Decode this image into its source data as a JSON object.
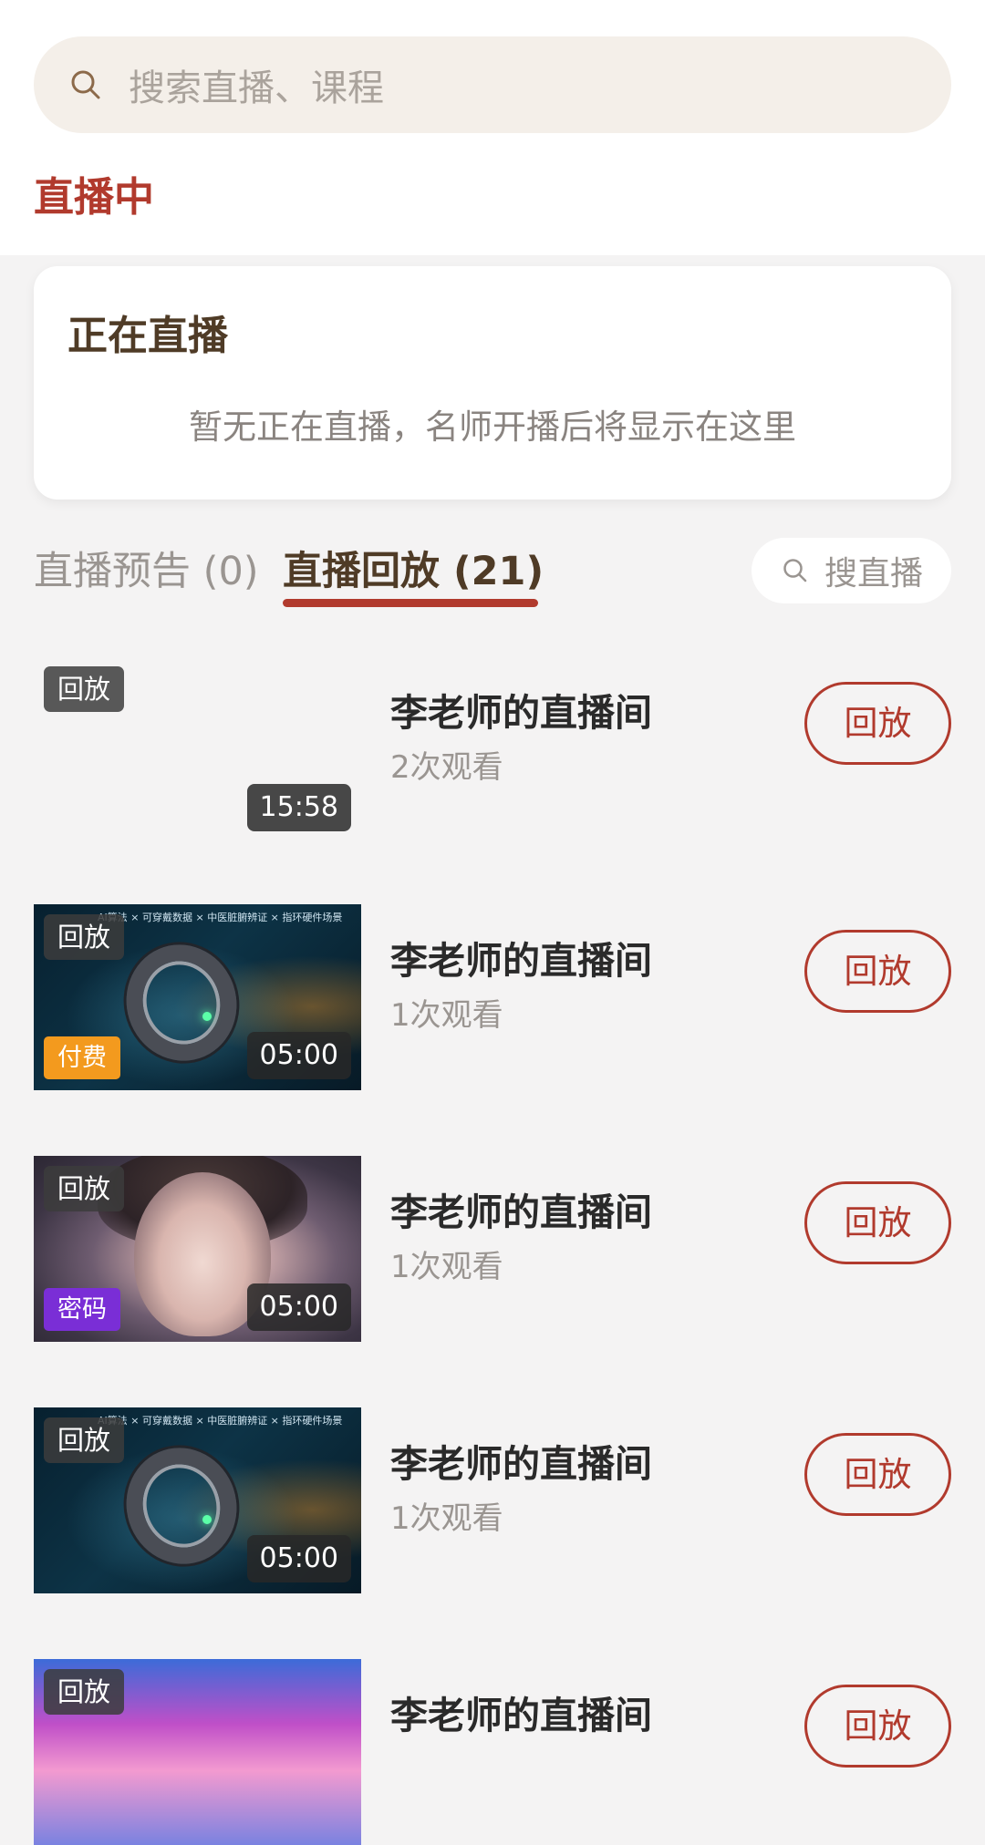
{
  "search": {
    "placeholder": "搜索直播、课程"
  },
  "section_title": "直播中",
  "live_now": {
    "title": "正在直播",
    "empty_text": "暂无正在直播，名师开播后将显示在这里"
  },
  "tabs": {
    "preview": "直播预告 (0)",
    "replay": "直播回放 (21)",
    "active": "replay"
  },
  "mini_search": {
    "label": "搜直播"
  },
  "thumbnail_caption": "AI算法 × 可穿戴数据 × 中医脏腑辨证 × 指环硬件场景",
  "colors": {
    "accent": "#b13a2d",
    "heading": "#4f3b26",
    "paid": "#f39a1e",
    "password": "#7a2ed6"
  },
  "replays": [
    {
      "badge": "回放",
      "tag": "",
      "tag_color": "",
      "duration": "15:58",
      "title": "李老师的直播间",
      "views": "2次观看",
      "button": "回放",
      "thumb": "blank"
    },
    {
      "badge": "回放",
      "tag": "付费",
      "tag_color": "#f39a1e",
      "duration": "05:00",
      "title": "李老师的直播间",
      "views": "1次观看",
      "button": "回放",
      "thumb": "ring"
    },
    {
      "badge": "回放",
      "tag": "密码",
      "tag_color": "#7a2ed6",
      "duration": "05:00",
      "title": "李老师的直播间",
      "views": "1次观看",
      "button": "回放",
      "thumb": "face"
    },
    {
      "badge": "回放",
      "tag": "",
      "tag_color": "",
      "duration": "05:00",
      "title": "李老师的直播间",
      "views": "1次观看",
      "button": "回放",
      "thumb": "ring"
    },
    {
      "badge": "回放",
      "tag": "",
      "tag_color": "",
      "duration": "",
      "title": "李老师的直播间",
      "views": "",
      "button": "回放",
      "thumb": "sky"
    }
  ]
}
